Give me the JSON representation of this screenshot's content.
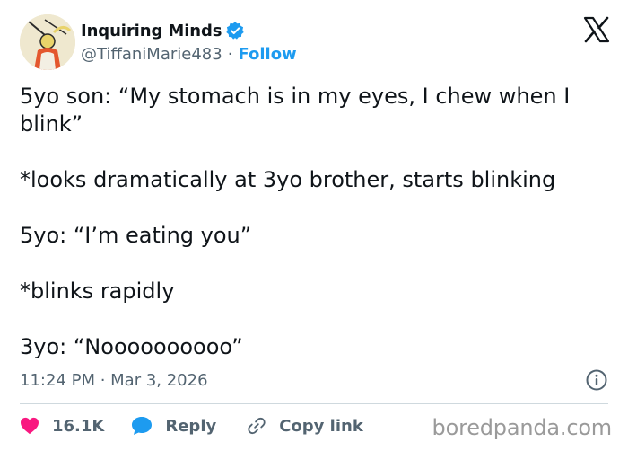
{
  "header": {
    "display_name": "Inquiring Minds",
    "handle": "@TiffaniMarie483",
    "separator": "·",
    "follow_label": "Follow",
    "verified_color": "#1d9bf0",
    "platform_icon": "x-logo-icon",
    "avatar_icon": "avatar-illustration"
  },
  "tweet": {
    "lines": [
      "5yo son: “My stomach is in my eyes, I chew when I blink”",
      "*looks dramatically at 3yo brother, starts blinking",
      "5yo: “I’m eating you”",
      "*blinks rapidly",
      "3yo: “Noooooooooo”"
    ],
    "timestamp": "11:24 PM · Mar 3, 2026",
    "info_icon": "info-icon"
  },
  "actions": {
    "like_count": "16.1K",
    "like_color": "#f91880",
    "reply_label": "Reply",
    "reply_color": "#1d9bf0",
    "copy_link_label": "Copy link"
  },
  "watermark": "boredpanda.com"
}
